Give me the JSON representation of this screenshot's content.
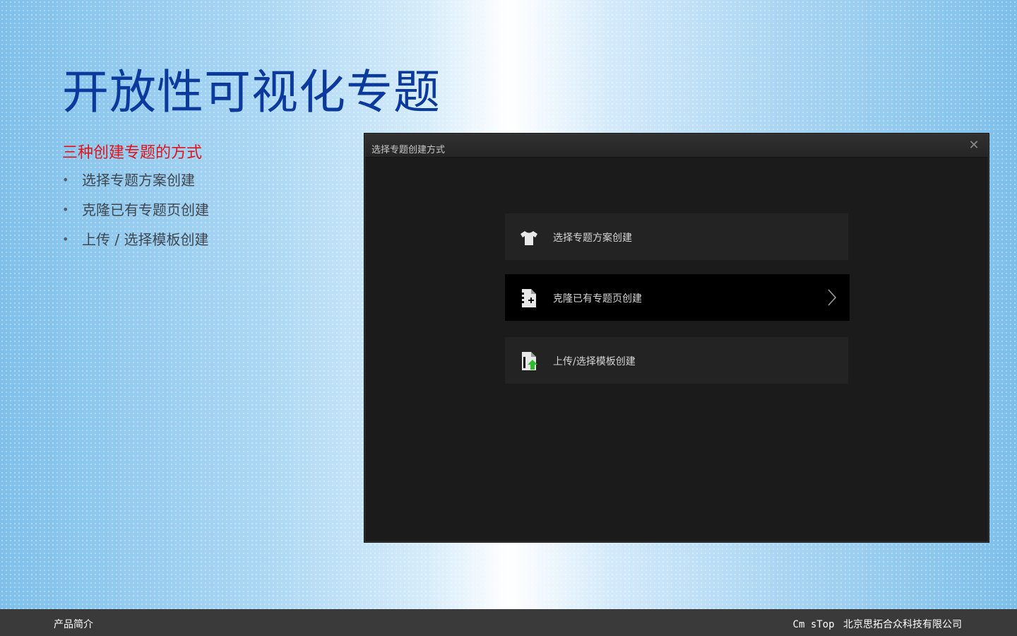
{
  "slide": {
    "title": "开放性可视化专题",
    "subtitle": "三种创建专题的方式",
    "bullets": [
      "选择专题方案创建",
      "克隆已有专题页创建",
      "上传 / 选择模板创建"
    ]
  },
  "dialog": {
    "title": "选择专题创建方式",
    "close_icon": "close-icon",
    "options": [
      {
        "label": "选择专题方案创建",
        "icon": "tshirt-icon",
        "active": false
      },
      {
        "label": "克隆已有专题页创建",
        "icon": "clone-document-icon",
        "active": true
      },
      {
        "label": "上传/选择模板创建",
        "icon": "upload-template-icon",
        "active": false
      }
    ]
  },
  "footer": {
    "left": "产品简介",
    "brand": "Cm sTop",
    "company": "北京思拓合众科技有限公司"
  },
  "colors": {
    "title": "#0b3a9c",
    "subtitle": "#e0141c",
    "dialog_bg": "#1b1b1b",
    "footer_bg": "#3a3a3a",
    "upload_arrow": "#2bbd2b"
  }
}
